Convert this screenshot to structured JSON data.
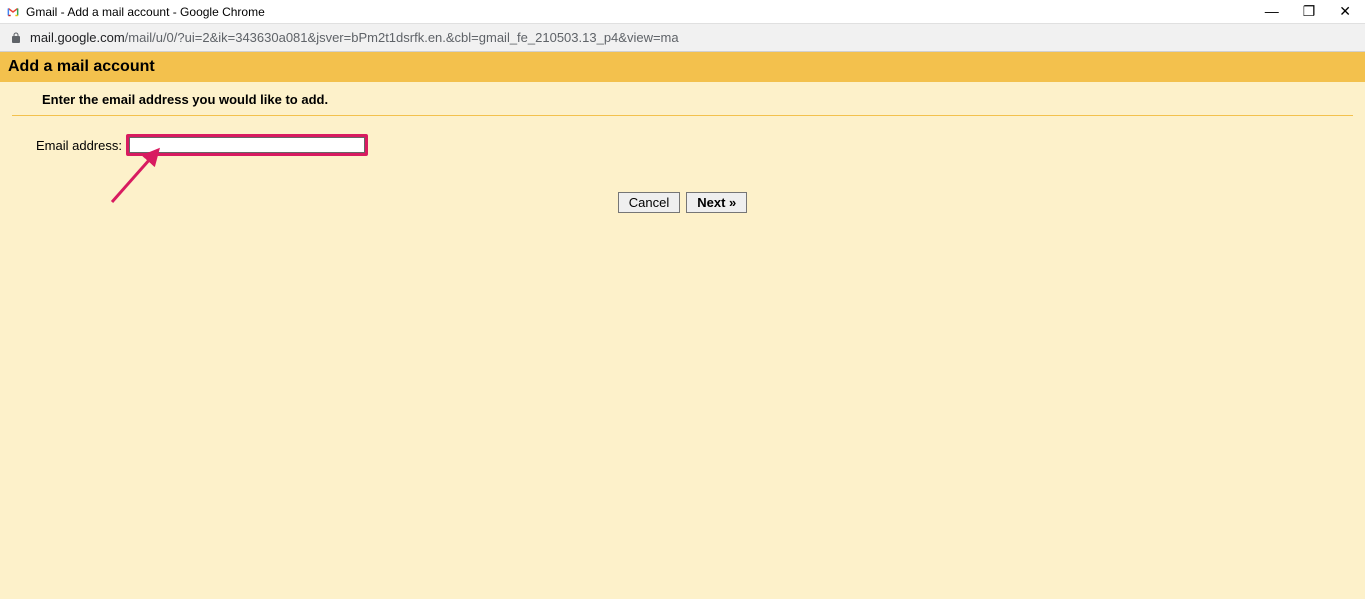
{
  "window": {
    "title": "Gmail - Add a mail account - Google Chrome"
  },
  "addressbar": {
    "host": "mail.google.com",
    "path": "/mail/u/0/?ui=2&ik=343630a081&jsver=bPm2t1dsrfk.en.&cbl=gmail_fe_210503.13_p4&view=ma"
  },
  "page": {
    "heading": "Add a mail account",
    "instruction": "Enter the email address you would like to add.",
    "email_label": "Email address:",
    "email_value": "",
    "cancel_label": "Cancel",
    "next_label": "Next »"
  }
}
